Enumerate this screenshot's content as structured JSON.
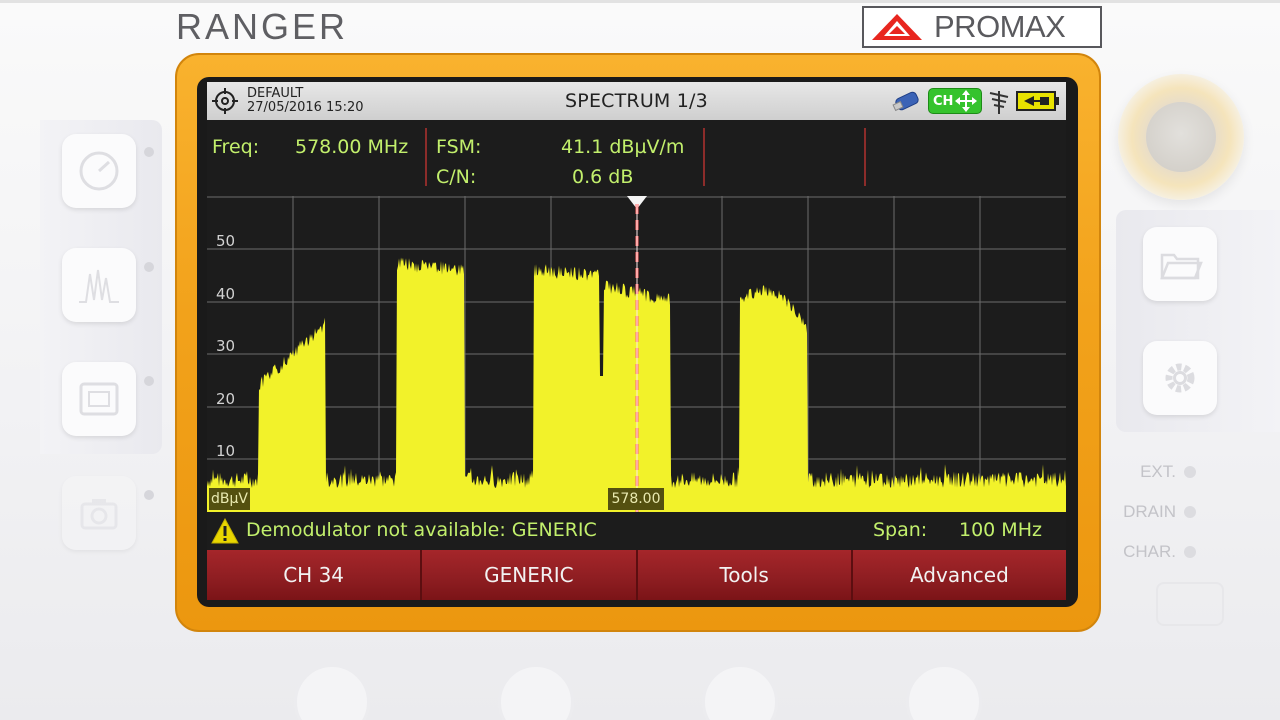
{
  "device": {
    "model": "RANGER",
    "brand": "PROMAX"
  },
  "screen": {
    "status_bar": {
      "config_name": "DEFAULT",
      "datetime": "27/05/2016 15:20",
      "title": "SPECTRUM 1/3",
      "ch_badge": "CH",
      "icons": [
        "target-icon",
        "usb-icon",
        "channel-arrows-icon",
        "antenna-icon",
        "battery-icon"
      ]
    },
    "measurements": {
      "freq_label": "Freq:",
      "freq_value": "578.00 MHz",
      "fsm_label": "FSM:",
      "fsm_value": "41.1 dBµV/m",
      "cn_label": "C/N:",
      "cn_value": "0.6 dB"
    },
    "graph": {
      "y_ticks": [
        "50",
        "40",
        "30",
        "20",
        "10"
      ],
      "unit": "dBµV",
      "marker_value": "578.00",
      "colors": {
        "trace": "#f2f22a",
        "marker": "#ff6a6a",
        "grid": "#6b6b6b",
        "background": "#1c1c1c"
      }
    },
    "info_bar": {
      "warning": "Demodulator not available: GENERIC",
      "span_label": "Span:",
      "span_value": "100 MHz"
    },
    "softkeys": [
      "CH 34",
      "GENERIC",
      "Tools",
      "Advanced"
    ]
  },
  "side_panel": {
    "status_labels": [
      "EXT.",
      "DRAIN",
      "CHAR."
    ]
  },
  "colors": {
    "frame": "#f2a21b",
    "softkey": "#8f1e22",
    "text_green": "#c2ef6c"
  }
}
